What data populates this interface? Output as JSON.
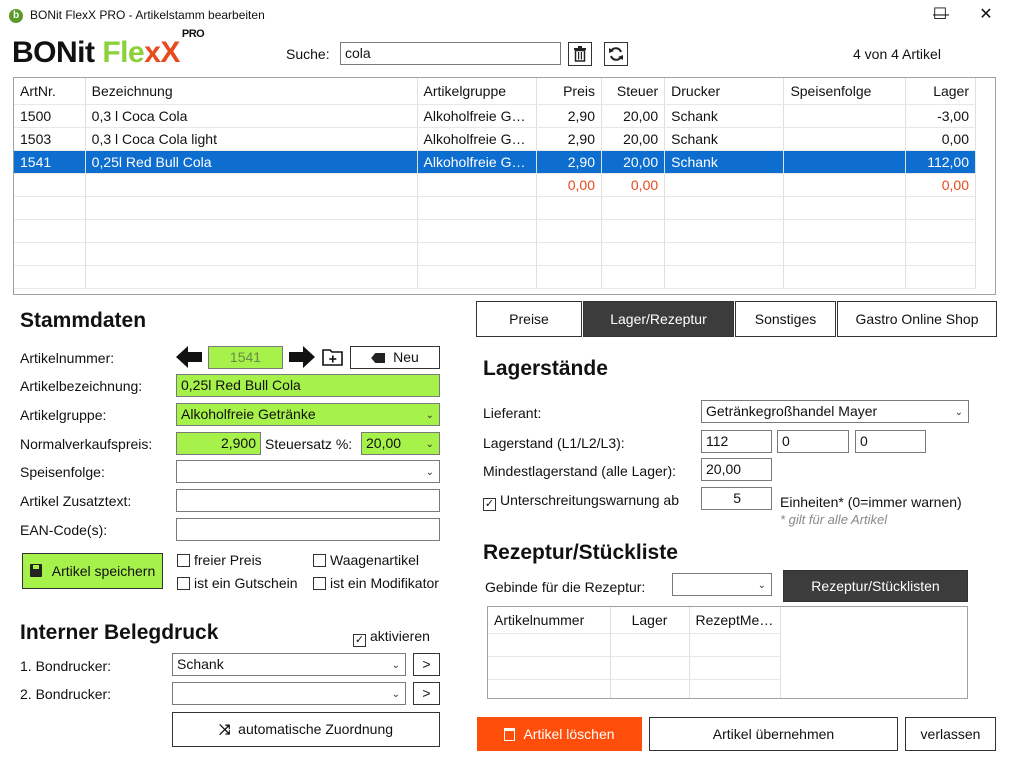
{
  "window": {
    "title": "BONit FlexX PRO - Artikelstamm bearbeiten",
    "icon": "app-logo-icon",
    "controls": [
      "minimize-icon",
      "maximize-icon",
      "close-icon"
    ]
  },
  "logo": {
    "part1": "BONit ",
    "part2": "Fle",
    "part3": "xX",
    "sup": "PRO"
  },
  "search": {
    "label": "Suche:",
    "value": "cola",
    "result_count": "4 von 4 Artikel"
  },
  "table": {
    "columns": [
      "ArtNr.",
      "Bezeichnung",
      "Artikelgruppe",
      "Preis",
      "Steuer",
      "Drucker",
      "Speisenfolge",
      "Lager"
    ],
    "rows": [
      [
        "1500",
        "0,3 l Coca Cola",
        "Alkoholfreie Getränke",
        "2,90",
        "20,00",
        "Schank",
        "",
        "-3,00"
      ],
      [
        "1503",
        "0,3 l Coca Cola light",
        "Alkoholfreie Getränke",
        "2,90",
        "20,00",
        "Schank",
        "",
        "0,00"
      ],
      [
        "1541",
        "0,25l Red Bull Cola",
        "Alkoholfreie Getränke",
        "2,90",
        "20,00",
        "Schank",
        "",
        "112,00"
      ]
    ],
    "totals": [
      "",
      "",
      "",
      "0,00",
      "0,00",
      "",
      "",
      "0,00"
    ],
    "selected_row": 2,
    "colors": {
      "selected": "#0d6ed0",
      "totals": "#e8491d"
    }
  },
  "stammdaten": {
    "title": "Stammdaten",
    "artikelnummer_label": "Artikelnummer:",
    "artikelnummer": "1541",
    "neu_label": "Neu",
    "bezeichnung_label": "Artikelbezeichnung:",
    "bezeichnung": "0,25l Red Bull Cola",
    "gruppe_label": "Artikelgruppe:",
    "gruppe": "Alkoholfreie Getränke",
    "preis_label": "Normalverkaufspreis:",
    "preis": "2,900",
    "steuer_label": "Steuersatz %:",
    "steuer": "20,00",
    "speisenfolge_label": "Speisenfolge:",
    "speisenfolge": "",
    "zusatztext_label": "Artikel Zusatztext:",
    "zusatztext": "",
    "ean_label": "EAN-Code(s):",
    "ean": "",
    "save_label": "Artikel speichern",
    "checkboxes": {
      "freier_preis": "freier Preis",
      "waagenartikel": "Waagenartikel",
      "gutschein": "ist ein Gutschein",
      "modifikator": "ist ein Modifikator"
    },
    "accent_color": "#a6f14a"
  },
  "belegdruck": {
    "title": "Interner Belegdruck",
    "aktivieren_label": "aktivieren",
    "aktivieren_checked": true,
    "drucker1_label": "1. Bondrucker:",
    "drucker1": "Schank",
    "drucker2_label": "2. Bondrucker:",
    "drucker2": "",
    "more_label": ">",
    "auto_label": "automatische Zuordnung"
  },
  "tabs": [
    {
      "label": "Preise",
      "active": false
    },
    {
      "label": "Lager/Rezeptur",
      "active": true
    },
    {
      "label": "Sonstiges",
      "active": false
    },
    {
      "label": "Gastro Online Shop",
      "active": false
    }
  ],
  "lager": {
    "title": "Lagerstände",
    "lieferant_label": "Lieferant:",
    "lieferant": "Getränkegroßhandel Mayer",
    "lagerstand_label": "Lagerstand (L1/L2/L3):",
    "l1": "112",
    "l2": "0",
    "l3": "0",
    "mindest_label": "Mindestlagerstand (alle Lager):",
    "mindest": "20,00",
    "warnung_label": "Unterschreitungswarnung ab",
    "warnung_checked": true,
    "warnung_value": "5",
    "einheiten_label": "Einheiten* (0=immer warnen)",
    "note": "* gilt für alle Artikel"
  },
  "rezeptur": {
    "title": "Rezeptur/Stückliste",
    "gebinde_label": "Gebinde für die Rezeptur:",
    "gebinde": "",
    "button_label": "Rezeptur/Stücklisten",
    "columns": [
      "Artikelnummer",
      "Lager",
      "RezeptMen..."
    ]
  },
  "footer": {
    "delete_label": "Artikel löschen",
    "apply_label": "Artikel übernehmen",
    "exit_label": "verlassen",
    "delete_color": "#ff4d0a"
  }
}
